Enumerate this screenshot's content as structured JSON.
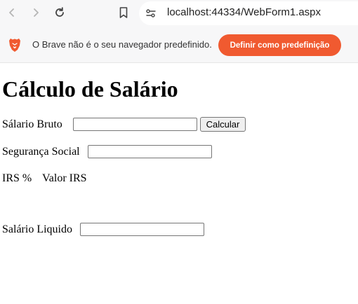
{
  "browser": {
    "url": "localhost:44334/WebForm1.aspx",
    "icons": {
      "back": "back-arrow-icon",
      "forward": "forward-arrow-icon",
      "reload": "reload-icon",
      "bookmark": "bookmark-icon",
      "site_info": "site-info-icon"
    }
  },
  "infobar": {
    "message": "O Brave não é o seu navegador predefinido.",
    "button_label": "Definir como predefinição",
    "accent_color": "#f05a30"
  },
  "page": {
    "title": "Cálculo de Salário",
    "gross_salary_label": "Sálario Bruto",
    "gross_salary_value": "",
    "calculate_label": "Calcular",
    "social_security_label": "Segurança Social",
    "social_security_value": "",
    "irs_percent_label": "IRS %",
    "irs_value_label": "Valor IRS",
    "net_salary_label": "Salário Liquido",
    "net_salary_value": ""
  }
}
